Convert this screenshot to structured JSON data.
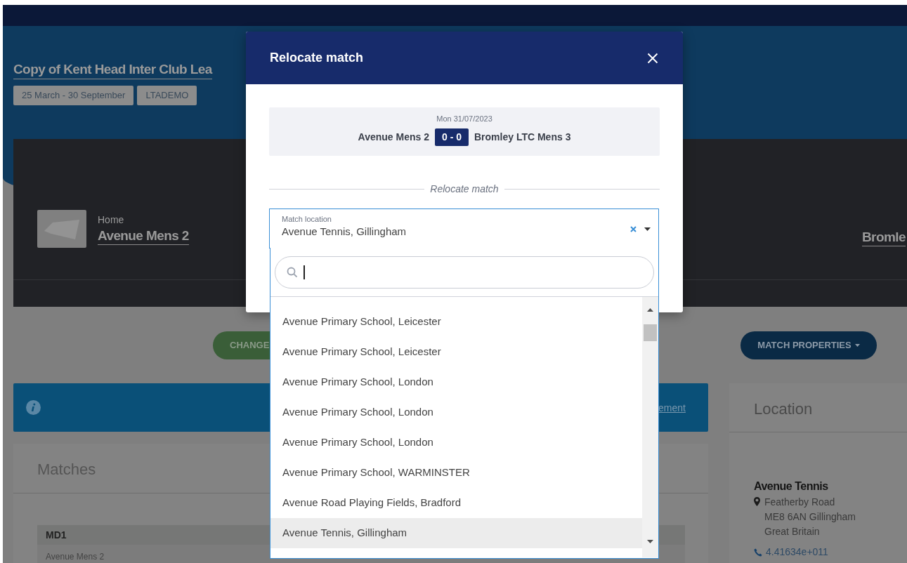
{
  "header": {
    "title": "Copy of Kent Head Inter Club Lea",
    "tags": [
      "25 March - 30 September",
      "LTADEMO"
    ]
  },
  "match_panel": {
    "home_label": "Home",
    "home_team": "Avenue Mens 2",
    "away_team": "Bromle"
  },
  "actions": {
    "change_button": "CHANGE",
    "properties_button": "MATCH PROPERTIES"
  },
  "info_banner": {
    "link": "ement"
  },
  "matches": {
    "title": "Matches",
    "group": "MD1",
    "row": "Avenue Mens 2"
  },
  "location": {
    "title": "Location",
    "venue": "Avenue Tennis",
    "address": [
      "Featherby Road",
      "ME8 6AN Gillingham",
      "Great Britain"
    ],
    "phone": "4.41634e+011"
  },
  "modal": {
    "title": "Relocate match",
    "date": "Mon 31/07/2023",
    "home_team": "Avenue Mens 2",
    "score": "0 - 0",
    "away_team": "Bromley LTC Mens 3",
    "section": "Relocate match",
    "field": {
      "label": "Match location",
      "value": "Avenue Tennis, Gillingham"
    },
    "options": [
      {
        "label": "Avenue Primary School, Leicester",
        "selected": false
      },
      {
        "label": "Avenue Primary School, Leicester",
        "selected": false
      },
      {
        "label": "Avenue Primary School, London",
        "selected": false
      },
      {
        "label": "Avenue Primary School, London",
        "selected": false
      },
      {
        "label": "Avenue Primary School, London",
        "selected": false
      },
      {
        "label": "Avenue Primary School, WARMINSTER",
        "selected": false
      },
      {
        "label": "Avenue Road Playing Fields, Bradford",
        "selected": false
      },
      {
        "label": "Avenue Tennis, Gillingham",
        "selected": true
      }
    ]
  }
}
